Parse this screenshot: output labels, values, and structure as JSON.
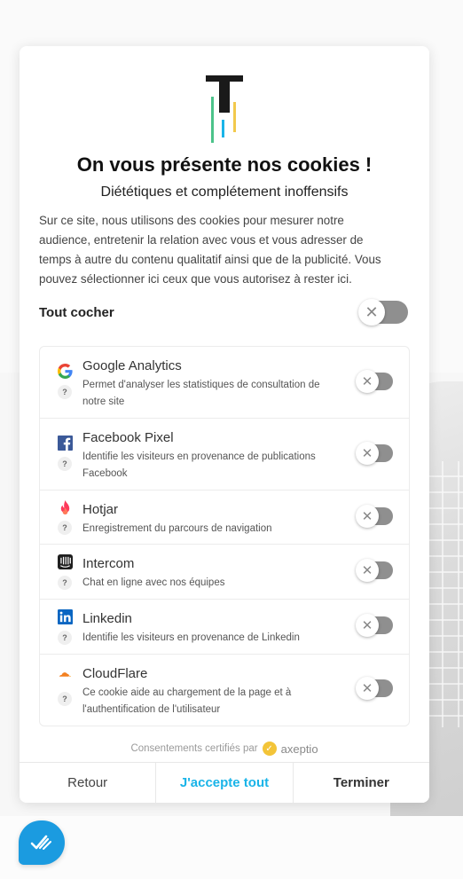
{
  "modal": {
    "title": "On vous présente nos cookies !",
    "subtitle": "Diététiques et complétement inoffensifs",
    "description": "Sur ce site, nous utilisons des cookies pour mesurer notre audience, entretenir la relation avec vous et vous adresser de temps à autre du contenu qualitatif ainsi que de la publicité. Vous pouvez sélectionner ici ceux que vous autorisez à rester ici.",
    "check_all_label": "Tout cocher",
    "check_all_enabled": false
  },
  "services": [
    {
      "name": "Google Analytics",
      "description": "Permet d'analyser les statistiques de consultation de notre site",
      "icon": "google-icon",
      "help": "?",
      "enabled": false
    },
    {
      "name": "Facebook Pixel",
      "description": "Identifie les visiteurs en provenance de publications Facebook",
      "icon": "facebook-icon",
      "help": "?",
      "enabled": false
    },
    {
      "name": "Hotjar",
      "description": "Enregistrement du parcours de navigation",
      "icon": "hotjar-icon",
      "help": "?",
      "enabled": false
    },
    {
      "name": "Intercom",
      "description": "Chat en ligne avec nos équipes",
      "icon": "intercom-icon",
      "help": "?",
      "enabled": false
    },
    {
      "name": "Linkedin",
      "description": "Identifie les visiteurs en provenance de Linkedin",
      "icon": "linkedin-icon",
      "help": "?",
      "enabled": false
    },
    {
      "name": "CloudFlare",
      "description": "Ce cookie aide au chargement de la page et à l'authentification de l'utilisateur",
      "icon": "cloudflare-icon",
      "help": "?",
      "enabled": false
    }
  ],
  "footer": {
    "credit": "Consentements certifiés par",
    "brand": "axeptio"
  },
  "buttons": {
    "back": "Retour",
    "accept_all": "J'accepte tout",
    "finish": "Terminer"
  },
  "colors": {
    "accent": "#1ab4e8",
    "widget": "#1b9be0",
    "toggle_off": "#8f8f8f"
  }
}
